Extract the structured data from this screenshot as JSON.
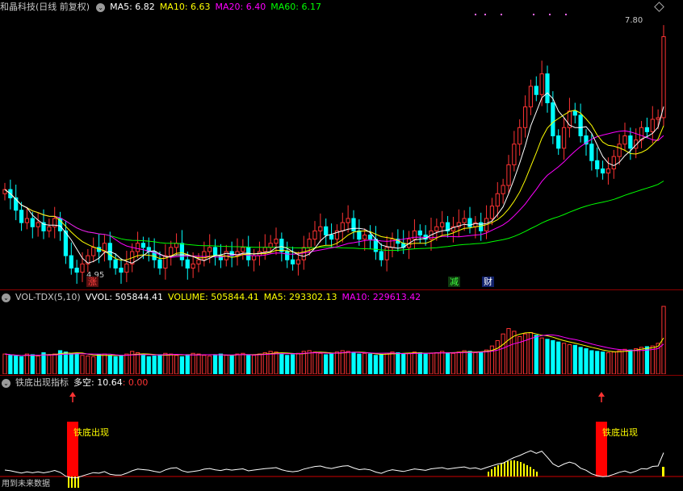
{
  "main": {
    "title": "和晶科技(日线 前复权)",
    "ma": [
      {
        "label": "MA5: 6.82",
        "color": "#ffffff"
      },
      {
        "label": "MA10: 6.63",
        "color": "#ffff00"
      },
      {
        "label": "MA20: 6.40",
        "color": "#ff00ff"
      },
      {
        "label": "MA60: 6.17",
        "color": "#00ff00"
      }
    ],
    "high_label": "7.80",
    "low_label": "4.95",
    "marks": [
      {
        "text": "涨",
        "color": "#ff4040",
        "bg": "#5a1010"
      },
      {
        "text": "减",
        "color": "#40ff40",
        "bg": "#0f3a0f"
      },
      {
        "text": "财",
        "color": "#ffffff",
        "bg": "#10206a"
      }
    ]
  },
  "vol": {
    "title": "VOL-TDX(5,10)",
    "items": [
      {
        "label": "VVOL: 505844.41",
        "color": "#ffffff"
      },
      {
        "label": "VOLUME: 505844.41",
        "color": "#ffff00"
      },
      {
        "label": "MA5: 293302.13",
        "color": "#ffff00"
      },
      {
        "label": "MA10: 229613.42",
        "color": "#ff00ff"
      }
    ]
  },
  "ind": {
    "title": "铁底出现指标",
    "duokong": "多空: 10.64",
    "zero": ": 0.00",
    "signal_label": "铁底出现",
    "footer": "用到未来数据"
  },
  "colors": {
    "up": "#ff3333",
    "down": "#00ffff",
    "ma5": "#ffffff",
    "ma10": "#ffff00",
    "ma20": "#ff00ff",
    "ma60": "#00ff00"
  },
  "chart_data": {
    "type": "candlestick",
    "close": [
      5.95,
      5.85,
      5.7,
      5.55,
      5.6,
      5.5,
      5.55,
      5.45,
      5.5,
      5.6,
      5.45,
      5.15,
      5.0,
      4.95,
      5.05,
      5.15,
      5.25,
      5.2,
      5.3,
      5.1,
      5.0,
      4.95,
      5.05,
      5.2,
      5.3,
      5.25,
      5.2,
      5.1,
      5.0,
      5.15,
      5.25,
      5.3,
      5.1,
      5.0,
      5.05,
      5.1,
      5.2,
      5.25,
      5.15,
      5.1,
      5.2,
      5.15,
      5.2,
      5.25,
      5.1,
      5.15,
      5.2,
      5.25,
      5.3,
      5.35,
      5.2,
      5.1,
      5.05,
      5.1,
      5.25,
      5.35,
      5.45,
      5.5,
      5.4,
      5.35,
      5.45,
      5.55,
      5.6,
      5.45,
      5.35,
      5.4,
      5.35,
      5.2,
      5.1,
      5.25,
      5.35,
      5.3,
      5.25,
      5.35,
      5.45,
      5.4,
      5.35,
      5.45,
      5.5,
      5.55,
      5.45,
      5.5,
      5.55,
      5.6,
      5.5,
      5.55,
      5.45,
      5.6,
      5.75,
      5.9,
      6.0,
      6.25,
      6.5,
      6.7,
      6.95,
      7.2,
      7.1,
      7.35,
      7.0,
      6.6,
      6.45,
      6.7,
      6.9,
      6.85,
      6.6,
      6.5,
      6.3,
      6.2,
      6.15,
      6.2,
      6.35,
      6.5,
      6.6,
      6.45,
      6.55,
      6.7,
      6.65,
      6.8,
      6.82,
      7.8
    ],
    "volume": [
      150,
      140,
      135,
      130,
      150,
      145,
      135,
      160,
      140,
      150,
      175,
      165,
      150,
      155,
      140,
      135,
      130,
      145,
      150,
      140,
      130,
      135,
      150,
      170,
      160,
      140,
      130,
      135,
      145,
      155,
      150,
      140,
      130,
      145,
      155,
      150,
      140,
      135,
      145,
      150,
      140,
      135,
      150,
      155,
      145,
      140,
      150,
      160,
      170,
      165,
      150,
      140,
      145,
      155,
      170,
      175,
      165,
      155,
      145,
      150,
      165,
      175,
      170,
      160,
      150,
      155,
      150,
      140,
      145,
      155,
      165,
      160,
      150,
      155,
      165,
      160,
      150,
      155,
      160,
      170,
      160,
      155,
      165,
      175,
      170,
      160,
      165,
      180,
      210,
      250,
      300,
      340,
      320,
      280,
      300,
      310,
      290,
      270,
      260,
      250,
      240,
      230,
      220,
      215,
      200,
      190,
      175,
      170,
      165,
      160,
      165,
      175,
      185,
      180,
      190,
      200,
      205,
      210,
      230,
      505.84
    ],
    "y_range": [
      4.8,
      8.0
    ]
  }
}
